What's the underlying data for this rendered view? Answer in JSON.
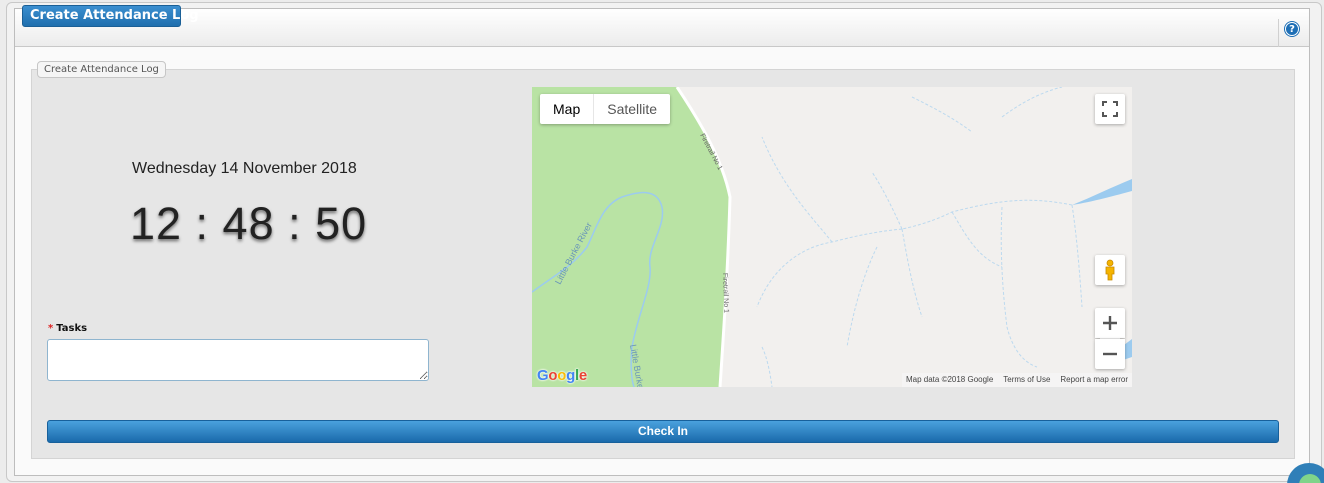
{
  "header": {
    "title": "Create Attendance Log",
    "help_icon": "help-icon"
  },
  "form": {
    "legend": "Create Attendance Log",
    "date": "Wednesday 14 November 2018",
    "clock": "12 : 48 : 50",
    "tasks_required_mark": "*",
    "tasks_label": "Tasks",
    "tasks_value": "",
    "check_in_label": "Check In"
  },
  "map": {
    "type_options": [
      "Map",
      "Satellite"
    ],
    "selected_type": "Map",
    "road_label": "Firetrail No 1",
    "river_label": "Little Burke River",
    "river_label_2": "Little Burke",
    "logo": [
      "G",
      "o",
      "o",
      "g",
      "l",
      "e"
    ],
    "footer": {
      "attribution": "Map data ©2018 Google",
      "terms": "Terms of Use",
      "report": "Report a map error"
    },
    "controls": [
      "fullscreen-icon",
      "pegman-icon",
      "zoom-in-icon",
      "zoom-out-icon"
    ]
  },
  "colors": {
    "accent": "#1f6fae",
    "park_green": "#b9e3a4",
    "water_blue": "#9ccbef"
  }
}
